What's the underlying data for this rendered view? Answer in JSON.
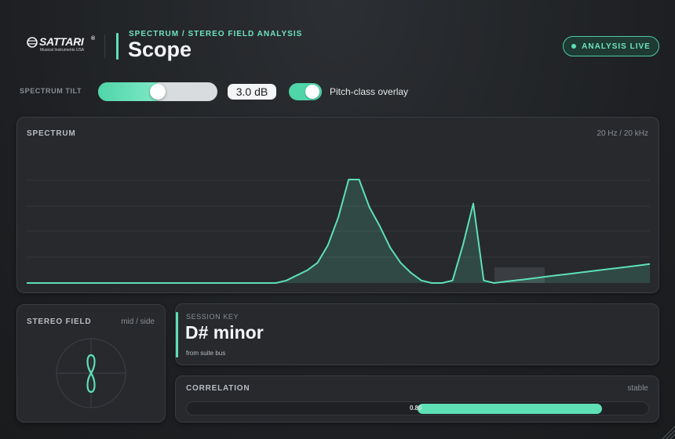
{
  "header": {
    "brand": "SATTARI",
    "brand_mark": "®",
    "brand_sub": "Musical Instruments USA",
    "eyebrow": "SPECTRUM / STEREO FIELD ANALYSIS",
    "title": "Scope",
    "status": "ANALYSIS LIVE"
  },
  "controls": {
    "tilt_label": "SPECTRUM TILT",
    "tilt_value": "3.0 dB",
    "tilt_fraction": 0.5,
    "overlay_label": "Pitch-class overlay",
    "overlay_on": true
  },
  "spectrum": {
    "title": "SPECTRUM",
    "range": "20 Hz / 20 kHz",
    "levels": [
      0,
      0,
      0,
      0,
      0,
      0,
      0,
      0,
      0,
      0,
      0,
      0,
      0,
      0,
      0,
      0,
      0,
      0,
      0,
      0,
      0,
      0,
      0,
      0,
      0,
      0.02,
      0.06,
      0.1,
      0.16,
      0.3,
      0.52,
      0.82,
      0.82,
      0.6,
      0.45,
      0.28,
      0.16,
      0.08,
      0.02,
      0,
      0,
      0.02,
      0.3,
      0.63,
      0.02,
      0,
      0.01,
      0.02,
      0.03,
      0.04,
      0.05,
      0.06,
      0.07,
      0.08,
      0.09,
      0.1,
      0.11,
      0.12,
      0.13,
      0.14,
      0.15
    ]
  },
  "stereo": {
    "title": "STEREO FIELD",
    "mode": "mid / side"
  },
  "session": {
    "label": "SESSION KEY",
    "key": "D# minor",
    "source": "from suite bus"
  },
  "correlation": {
    "title": "CORRELATION",
    "state": "stable",
    "value_label": "0.80",
    "value": 0.8
  },
  "colors": {
    "accent": "#5ee0b5",
    "panel": "#27292d",
    "background": "#1d1f22"
  }
}
